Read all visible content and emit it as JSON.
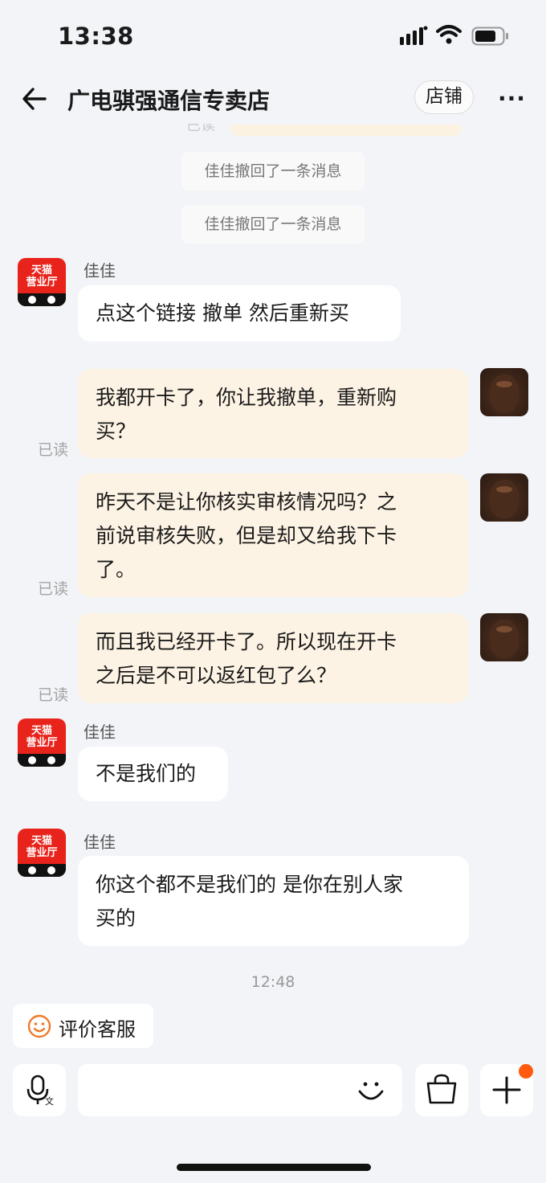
{
  "status": {
    "time": "13:38"
  },
  "nav": {
    "shop_name": "广电骐强通信专卖店",
    "shop_button": "店铺",
    "more": "···"
  },
  "system_messages": [
    "佳佳撤回了一条消息",
    "佳佳撤回了一条消息"
  ],
  "shop_avatar": {
    "line1": "天猫",
    "line2": "营业厅",
    "color": "#e8231b"
  },
  "messages": [
    {
      "sender": "佳佳",
      "from": "shop",
      "text": "点这个链接 撤单 然后重新买"
    },
    {
      "from": "me",
      "read": "已读",
      "lines": [
        "我都开卡了，你让我撤单，重新购",
        "买？"
      ]
    },
    {
      "from": "me",
      "read": "已读",
      "lines": [
        "昨天不是让你核实审核情况吗？之",
        "前说审核失败，但是却又给我下卡",
        "了。"
      ]
    },
    {
      "from": "me",
      "read": "已读",
      "lines": [
        "而且我已经开卡了。所以现在开卡",
        "之后是不可以返红包了么？"
      ]
    },
    {
      "sender": "佳佳",
      "from": "shop",
      "text": "不是我们的"
    },
    {
      "sender": "佳佳",
      "from": "shop",
      "lines": [
        "你这个都不是我们的 是你在别人家",
        "买的"
      ]
    }
  ],
  "timestamp": "12:48",
  "rate_button": "评价客服",
  "colors": {
    "accent": "#ff5a0f",
    "my_bubble": "#fdf3e4",
    "background": "#f2f4f7"
  }
}
